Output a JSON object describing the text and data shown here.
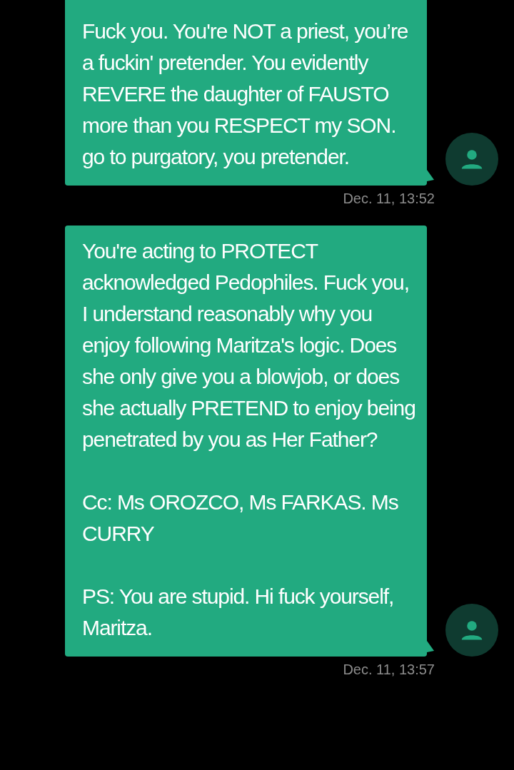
{
  "messages": [
    {
      "paragraphs": [
        "Fuck you. You're NOT a priest, you’re a fuckin' pretender. You evidently REVERE the daughter of FAUSTO more than you RESPECT my SON. go to purgatory, you pretender."
      ],
      "time": "Dec. 11, 13:52"
    },
    {
      "paragraphs": [
        "You're acting to PROTECT acknowledged Pedophiles. Fuck you, I understand reasonably why you enjoy following Maritza's logic. Does she only give you a blowjob, or does she actually PRETEND to enjoy being penetrated by you as Her Father?",
        "Cc: Ms OROZCO, Ms FARKAS. Ms CURRY",
        "PS: You are stupid. Hi fuck yourself, Maritza."
      ],
      "time": "Dec. 11, 13:57"
    }
  ]
}
